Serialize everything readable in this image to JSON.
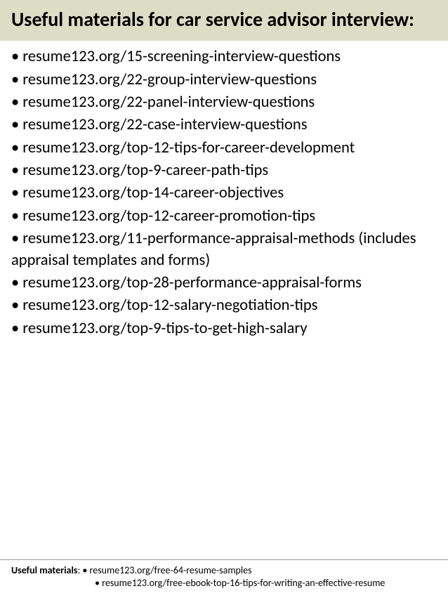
{
  "header": {
    "title": "Useful materials for car service advisor interview:"
  },
  "items": [
    "• resume123.org/15-screening-interview-questions",
    "• resume123.org/22-group-interview-questions",
    "• resume123.org/22-panel-interview-questions",
    "• resume123.org/22-case-interview-questions",
    "• resume123.org/top-12-tips-for-career-development",
    "• resume123.org/top-9-career-path-tips",
    "• resume123.org/top-14-career-objectives",
    "• resume123.org/top-12-career-promotion-tips",
    "• resume123.org/11-performance-appraisal-methods (includes appraisal templates and forms)",
    "• resume123.org/top-28-performance-appraisal-forms",
    "• resume123.org/top-12-salary-negotiation-tips",
    "• resume123.org/top-9-tips-to-get-high-salary"
  ],
  "footer": {
    "label": "Useful materials",
    "sep": ": ",
    "line1": "• resume123.org/free-64-resume-samples",
    "line2": "• resume123.org/free-ebook-top-16-tips-for-writing-an-effective-resume"
  }
}
